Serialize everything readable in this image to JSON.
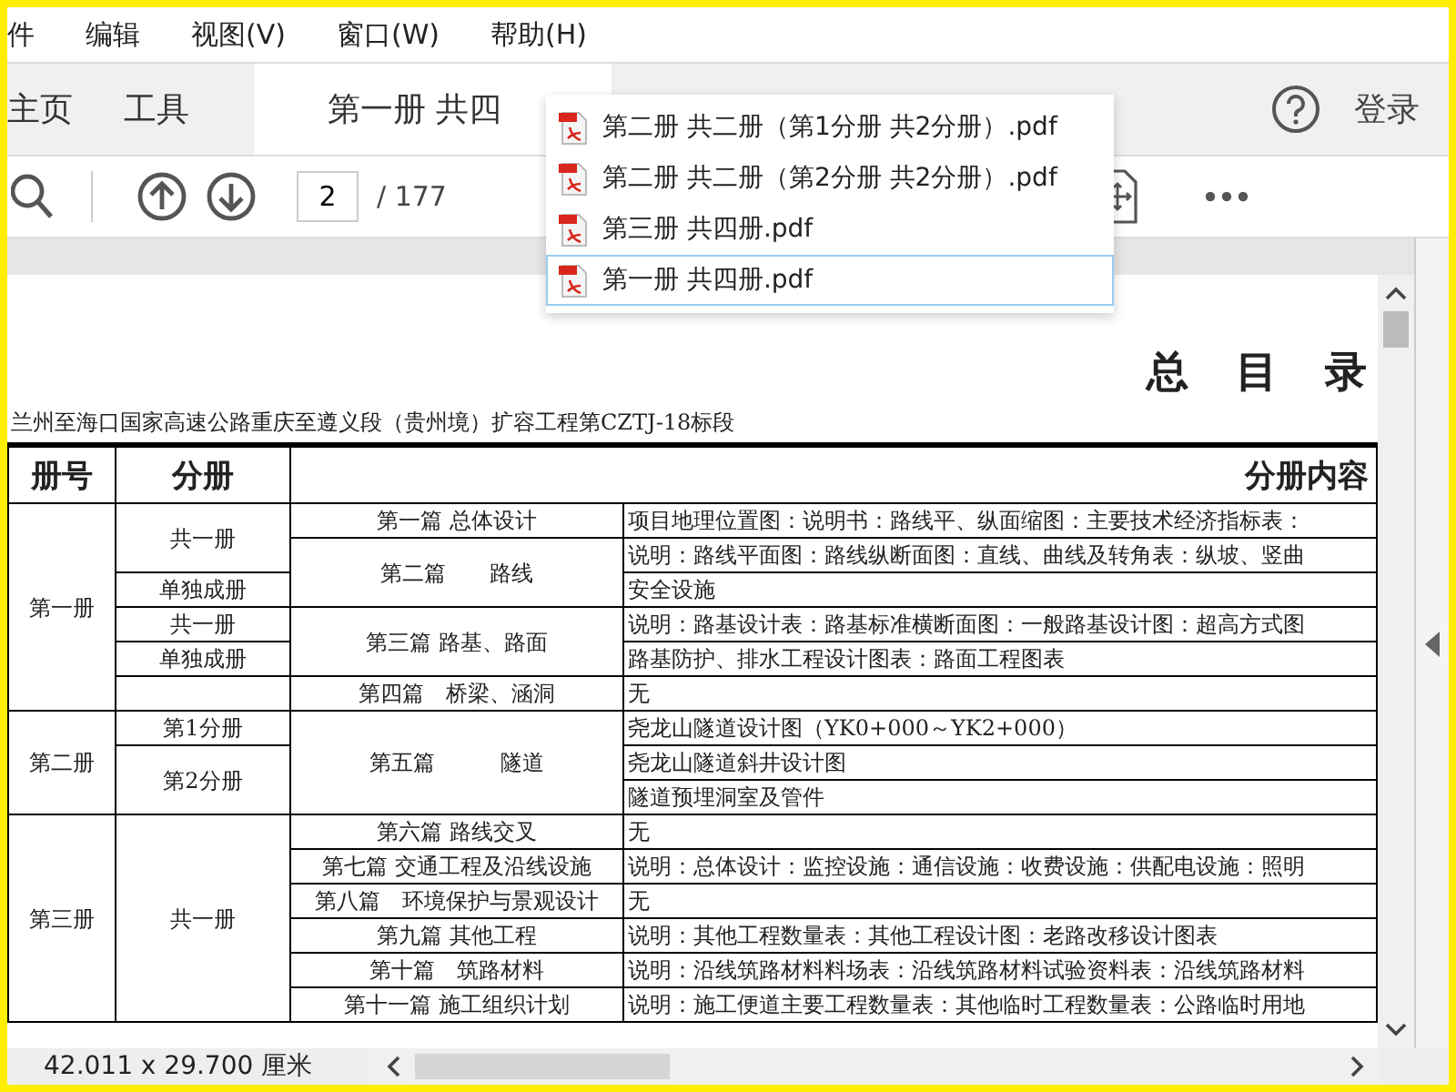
{
  "menu": [
    "件",
    "编辑",
    "视图(V)",
    "窗口(W)",
    "帮助(H)"
  ],
  "tabs": [
    {
      "label": "主页",
      "selected": false
    },
    {
      "label": "工具",
      "selected": false
    },
    {
      "label": "第一册 共四",
      "selected": true
    }
  ],
  "login": "登录",
  "toolbar": {
    "page": "2",
    "total": "/ 177"
  },
  "file_menu": [
    {
      "label": "第二册 共二册（第1分册 共2分册）.pdf",
      "selected": false
    },
    {
      "label": "第二册 共二册（第2分册 共2分册）.pdf",
      "selected": false
    },
    {
      "label": "第三册 共四册.pdf",
      "selected": false
    },
    {
      "label": "第一册 共四册.pdf",
      "selected": true
    }
  ],
  "document": {
    "title": "总 目 录",
    "subtitle": "兰州至海口国家高速公路重庆至遵义段（贵州境）扩容工程第CZTJ-18标段",
    "table": {
      "columns": [
        "册号",
        "分册",
        "分册内容"
      ],
      "rows": [
        {
          "volume": "第一册",
          "part": "共一册",
          "section": "第一篇 总体设计",
          "content": "项目地理位置图：说明书：路线平、纵面缩图：主要技术经济指标表："
        },
        {
          "section": "第二篇　　路线",
          "content": "说明：路线平面图：路线纵断面图：直线、曲线及转角表：纵坡、竖曲"
        },
        {
          "part": "单独成册",
          "content": "安全设施"
        },
        {
          "part": "共一册",
          "section": "第三篇 路基、路面",
          "content": "说明：路基设计表：路基标准横断面图：一般路基设计图：超高方式图"
        },
        {
          "part": "单独成册",
          "content": "路基防护、排水工程设计图表：路面工程图表"
        },
        {
          "part": null,
          "section": "第四篇　桥梁、涵洞",
          "content": "无"
        },
        {
          "volume": "第二册",
          "part": "第1分册",
          "section": "第五篇　　　隧道",
          "content": "尧龙山隧道设计图（YK0+000～YK2+000）"
        },
        {
          "part": "第2分册",
          "content": "尧龙山隧道斜井设计图"
        },
        {
          "content": "隧道预埋洞室及管件"
        },
        {
          "volume": "第三册",
          "part": "共一册",
          "section": "第六篇 路线交叉",
          "content": "无"
        },
        {
          "section": "第七篇 交通工程及沿线设施",
          "content": "说明：总体设计：监控设施：通信设施：收费设施：供配电设施：照明"
        },
        {
          "section": "第八篇　环境保护与景观设计",
          "content": "无"
        },
        {
          "section": "第九篇 其他工程",
          "content": "说明：其他工程数量表：其他工程设计图：老路改移设计图表"
        },
        {
          "section": "第十篇　筑路材料",
          "content": "说明：沿线筑路材料料场表：沿线筑路材料试验资料表：沿线筑路材料"
        },
        {
          "section": "第十一篇 施工组织计划",
          "content": "说明：施工便道主要工程数量表：其他临时工程数量表：公路临时用地"
        }
      ]
    }
  },
  "status_bar": {
    "size": "42.011 x 29.700 厘米"
  }
}
